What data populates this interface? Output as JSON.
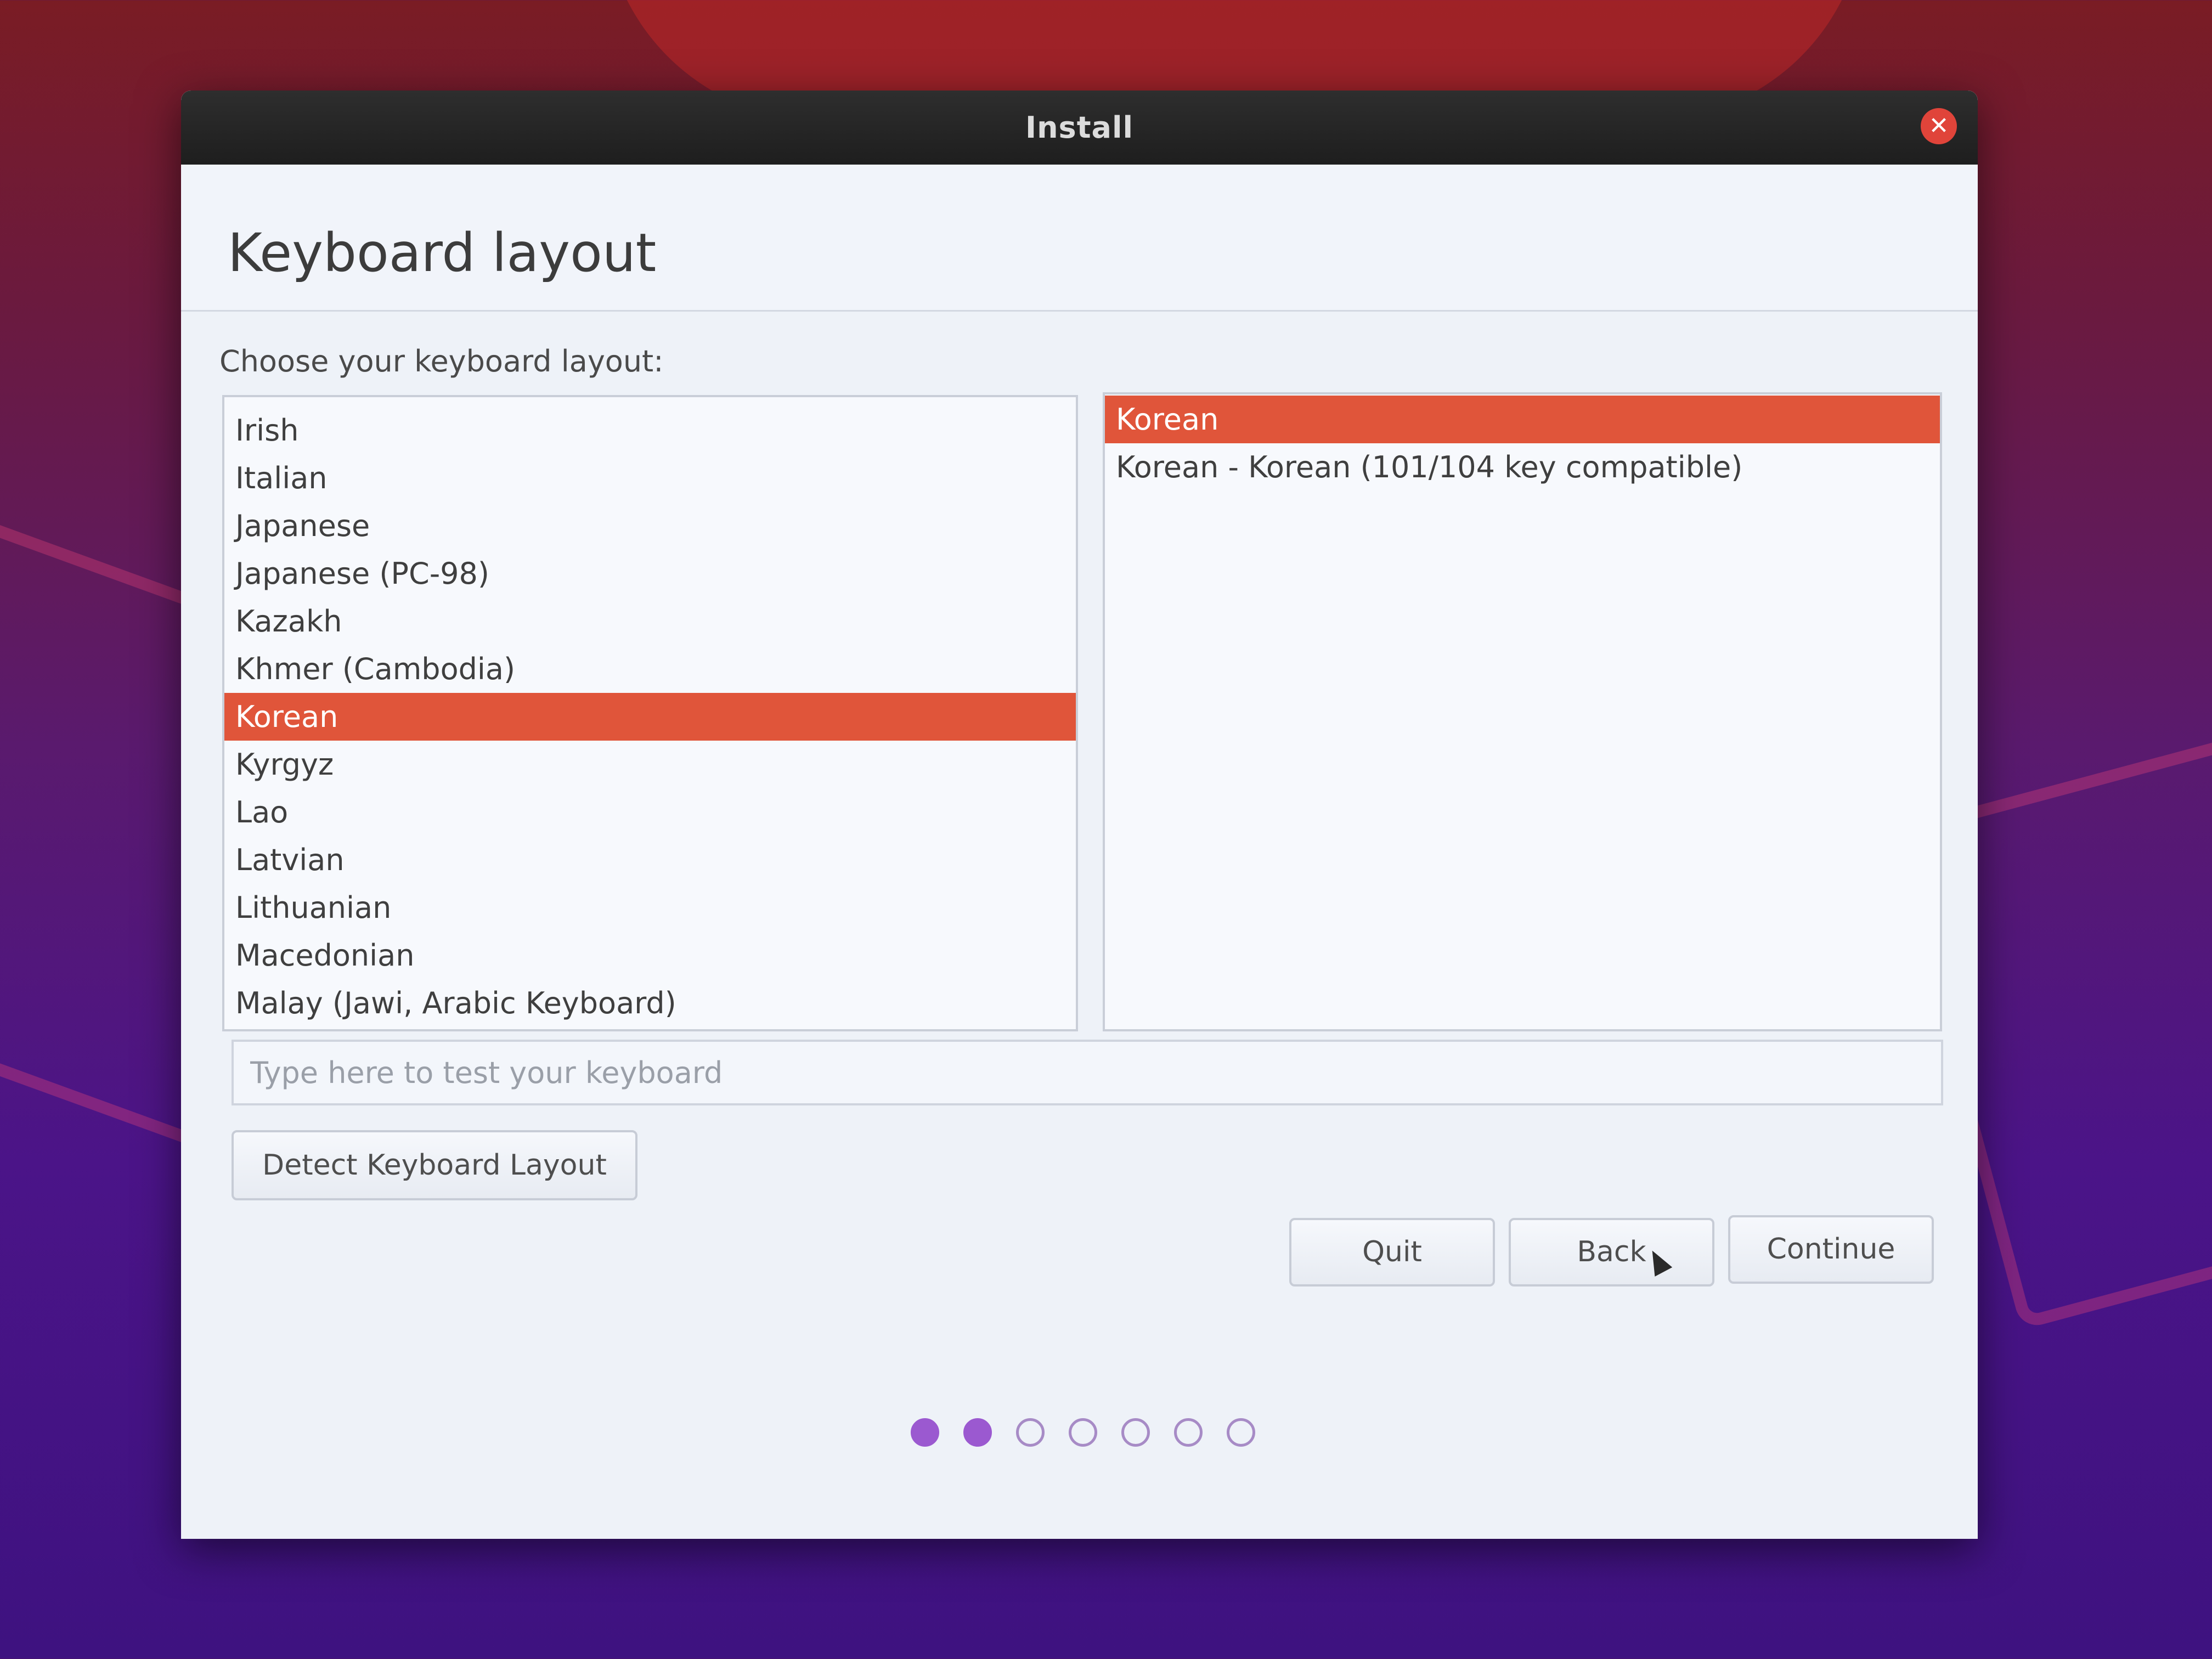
{
  "window": {
    "title": "Install"
  },
  "page": {
    "title": "Keyboard layout",
    "prompt": "Choose your keyboard layout:"
  },
  "layouts": {
    "items": [
      "Irish",
      "Italian",
      "Japanese",
      "Japanese (PC-98)",
      "Kazakh",
      "Khmer (Cambodia)",
      "Korean",
      "Kyrgyz",
      "Lao",
      "Latvian",
      "Lithuanian",
      "Macedonian",
      "Malay (Jawi, Arabic Keyboard)"
    ],
    "selected_index": 6
  },
  "variants": {
    "items": [
      "Korean",
      "Korean - Korean (101/104 key compatible)"
    ],
    "selected_index": 0
  },
  "test_input": {
    "placeholder": "Type here to test your keyboard",
    "value": ""
  },
  "buttons": {
    "detect": "Detect Keyboard Layout",
    "quit": "Quit",
    "back": "Back",
    "continue": "Continue"
  },
  "progress": {
    "total_steps": 7,
    "completed_steps": 2
  },
  "colors": {
    "selection": "#e0553a",
    "progress_dot": "#9b59d0",
    "close_button": "#e0443a"
  }
}
